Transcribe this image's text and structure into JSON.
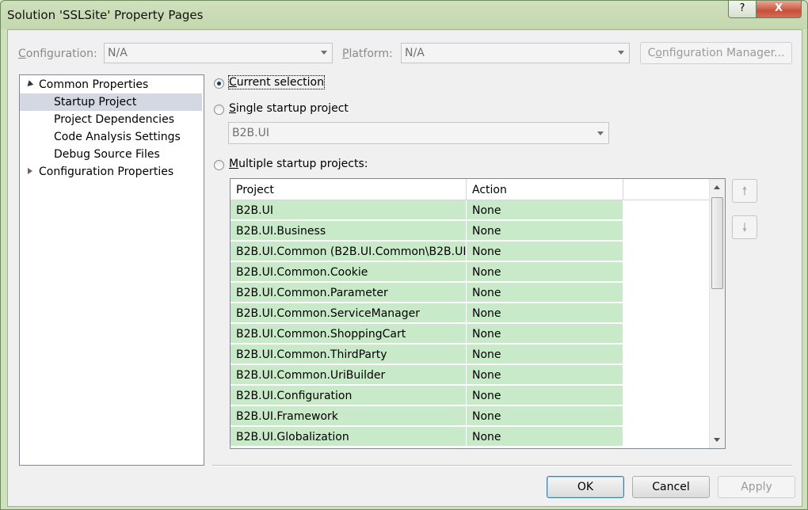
{
  "window": {
    "title": "Solution 'SSLSite' Property Pages",
    "help_label": "?",
    "close_label": "X"
  },
  "config": {
    "configuration_label": "Configuration:",
    "configuration_value": "N/A",
    "platform_label": "Platform:",
    "platform_value": "N/A",
    "manager_button": "Configuration Manager..."
  },
  "tree": {
    "common": "Common Properties",
    "items": [
      "Startup Project",
      "Project Dependencies",
      "Code Analysis Settings",
      "Debug Source Files"
    ],
    "config_props": "Configuration Properties"
  },
  "options": {
    "current_selection": "Current selection",
    "single_startup": "Single startup project",
    "single_value": "B2B.UI",
    "multiple_startup": "Multiple startup projects:",
    "selected": "current_selection"
  },
  "grid": {
    "columns": [
      "Project",
      "Action"
    ],
    "rows": [
      {
        "project": "B2B.UI",
        "action": "None"
      },
      {
        "project": "B2B.UI.Business",
        "action": "None"
      },
      {
        "project": "B2B.UI.Common (B2B.UI.Common\\B2B.UI....",
        "action": "None"
      },
      {
        "project": "B2B.UI.Common.Cookie",
        "action": "None"
      },
      {
        "project": "B2B.UI.Common.Parameter",
        "action": "None"
      },
      {
        "project": "B2B.UI.Common.ServiceManager",
        "action": "None"
      },
      {
        "project": "B2B.UI.Common.ShoppingCart",
        "action": "None"
      },
      {
        "project": "B2B.UI.Common.ThirdParty",
        "action": "None"
      },
      {
        "project": "B2B.UI.Common.UriBuilder",
        "action": "None"
      },
      {
        "project": "B2B.UI.Configuration",
        "action": "None"
      },
      {
        "project": "B2B.UI.Framework",
        "action": "None"
      },
      {
        "project": "B2B.UI.Globalization",
        "action": "None"
      }
    ],
    "row_fill": "#c8eac8"
  },
  "buttons": {
    "ok": "OK",
    "cancel": "Cancel",
    "apply": "Apply",
    "move_up_icon": "arrow-up",
    "move_down_icon": "arrow-down"
  }
}
